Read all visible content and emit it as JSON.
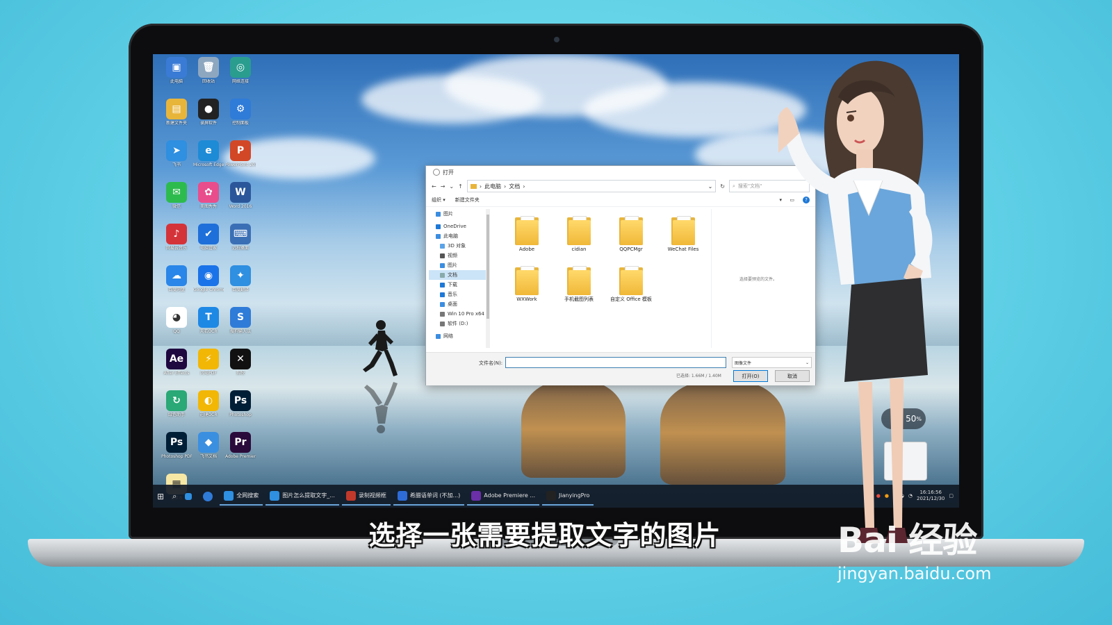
{
  "dialog": {
    "title": "打开",
    "address": [
      "此电脑",
      "文档"
    ],
    "search_placeholder": "搜索\"文档\"",
    "cmd": {
      "organize": "组织 ▾",
      "new_folder": "新建文件夹"
    },
    "nav": [
      {
        "label": "图片",
        "icon": "picture-icon"
      },
      {
        "label": "OneDrive",
        "icon": "cloud-icon"
      },
      {
        "label": "此电脑",
        "icon": "pc-icon"
      },
      {
        "label": "3D 对象",
        "icon": "cube-icon"
      },
      {
        "label": "视频",
        "icon": "video-icon"
      },
      {
        "label": "图片",
        "icon": "picture-icon"
      },
      {
        "label": "文档",
        "icon": "document-icon"
      },
      {
        "label": "下载",
        "icon": "download-icon"
      },
      {
        "label": "音乐",
        "icon": "music-icon"
      },
      {
        "label": "桌面",
        "icon": "desktop-icon"
      },
      {
        "label": "Win 10 Pro x64",
        "icon": "drive-icon"
      },
      {
        "label": "软件 (D:)",
        "icon": "drive-icon"
      },
      {
        "label": "网络",
        "icon": "network-icon"
      }
    ],
    "files": [
      {
        "name": "Adobe"
      },
      {
        "name": "cidian"
      },
      {
        "name": "QQPCMgr"
      },
      {
        "name": "WeChat Files"
      },
      {
        "name": "WXWork"
      },
      {
        "name": "手机截图列表"
      },
      {
        "name": "自定义 Office 模板"
      }
    ],
    "preview_hint": "选择要预览的文件。",
    "filename_label": "文件名(N):",
    "filename_value": "",
    "filetype": "图像文件",
    "status": "已选择: 1.66M / 1.40M",
    "open_label": "打开(O)",
    "cancel_label": "取消"
  },
  "taskbar": {
    "items": [
      {
        "label": "全网搜索",
        "color": "#2f8fe0"
      },
      {
        "label": "图片怎么提取文字_...",
        "color": "#2f8fe0"
      },
      {
        "label": "录制视频框",
        "color": "#c0392b"
      },
      {
        "label": "希腊语单词 (不加...)",
        "color": "#2e6bd6"
      },
      {
        "label": "Adobe Premiere ...",
        "color": "#6b2fa8"
      },
      {
        "label": "JianyingPro",
        "color": "#222222"
      }
    ],
    "time": "16:16:56",
    "date": "2021/12/30"
  },
  "desktop_icons": [
    {
      "label": "此电脑",
      "color": "#3a7bd5",
      "glyph": "▣"
    },
    {
      "label": "回收站",
      "color": "#8ea7c0",
      "glyph": "🗑"
    },
    {
      "label": "网络连接",
      "color": "#2a9d8f",
      "glyph": "◎"
    },
    {
      "label": "新建文件夹",
      "color": "#e8b53b",
      "glyph": "▤"
    },
    {
      "label": "录屏软件",
      "color": "#222222",
      "glyph": "●"
    },
    {
      "label": "控制面板",
      "color": "#2f7bd8",
      "glyph": "⚙"
    },
    {
      "label": "飞书",
      "color": "#2f8fe0",
      "glyph": "➤"
    },
    {
      "label": "Microsoft Edge",
      "color": "#1d8bd6",
      "glyph": "e"
    },
    {
      "label": "PowerPoint 2016",
      "color": "#d24726",
      "glyph": "P"
    },
    {
      "label": "微信",
      "color": "#2dbb4e",
      "glyph": "✉"
    },
    {
      "label": "美图秀秀",
      "color": "#e94d8b",
      "glyph": "✿"
    },
    {
      "label": "Word 2016",
      "color": "#2b579a",
      "glyph": "W"
    },
    {
      "label": "网易云音乐",
      "color": "#d4333a",
      "glyph": "♪"
    },
    {
      "label": "电脑管家",
      "color": "#1e6fd9",
      "glyph": "✔"
    },
    {
      "label": "远程桌面",
      "color": "#3b6fb5",
      "glyph": "⌨"
    },
    {
      "label": "百度网盘",
      "color": "#2a86e8",
      "glyph": "☁"
    },
    {
      "label": "Google Chrome",
      "color": "#1a73e8",
      "glyph": "◉"
    },
    {
      "label": "百度翻译",
      "color": "#2f8fe0",
      "glyph": "✦"
    },
    {
      "label": "QQ",
      "color": "#ffffff",
      "glyph": "◕"
    },
    {
      "label": "天若OCR",
      "color": "#1e88e5",
      "glyph": "T"
    },
    {
      "label": "搜狗输入法",
      "color": "#2f7bd8",
      "glyph": "S"
    },
    {
      "label": "After Effects",
      "color": "#1f0740",
      "glyph": "Ae"
    },
    {
      "label": "闪电PDF",
      "color": "#f2b705",
      "glyph": "⚡"
    },
    {
      "label": "剪映",
      "color": "#111111",
      "glyph": "✕"
    },
    {
      "label": "绿色助手",
      "color": "#2aa876",
      "glyph": "↻"
    },
    {
      "label": "迅捷OCR",
      "color": "#f2b705",
      "glyph": "◐"
    },
    {
      "label": "Photoshop",
      "color": "#001e36",
      "glyph": "Ps"
    },
    {
      "label": "Photoshop PDF",
      "color": "#001e36",
      "glyph": "Ps"
    },
    {
      "label": "飞书文档",
      "color": "#3a8fe0",
      "glyph": "◆"
    },
    {
      "label": "Adobe Premiere",
      "color": "#2a0a3a",
      "glyph": "Pr"
    },
    {
      "label": "记事本",
      "color": "#f6e7a5",
      "glyph": "▦"
    }
  ],
  "widgets": {
    "speed": "50"
  },
  "subtitle": "选择一张需要提取文字的图片",
  "watermark": {
    "main": "Bai 经验",
    "sub": "jingyan.baidu.com"
  }
}
